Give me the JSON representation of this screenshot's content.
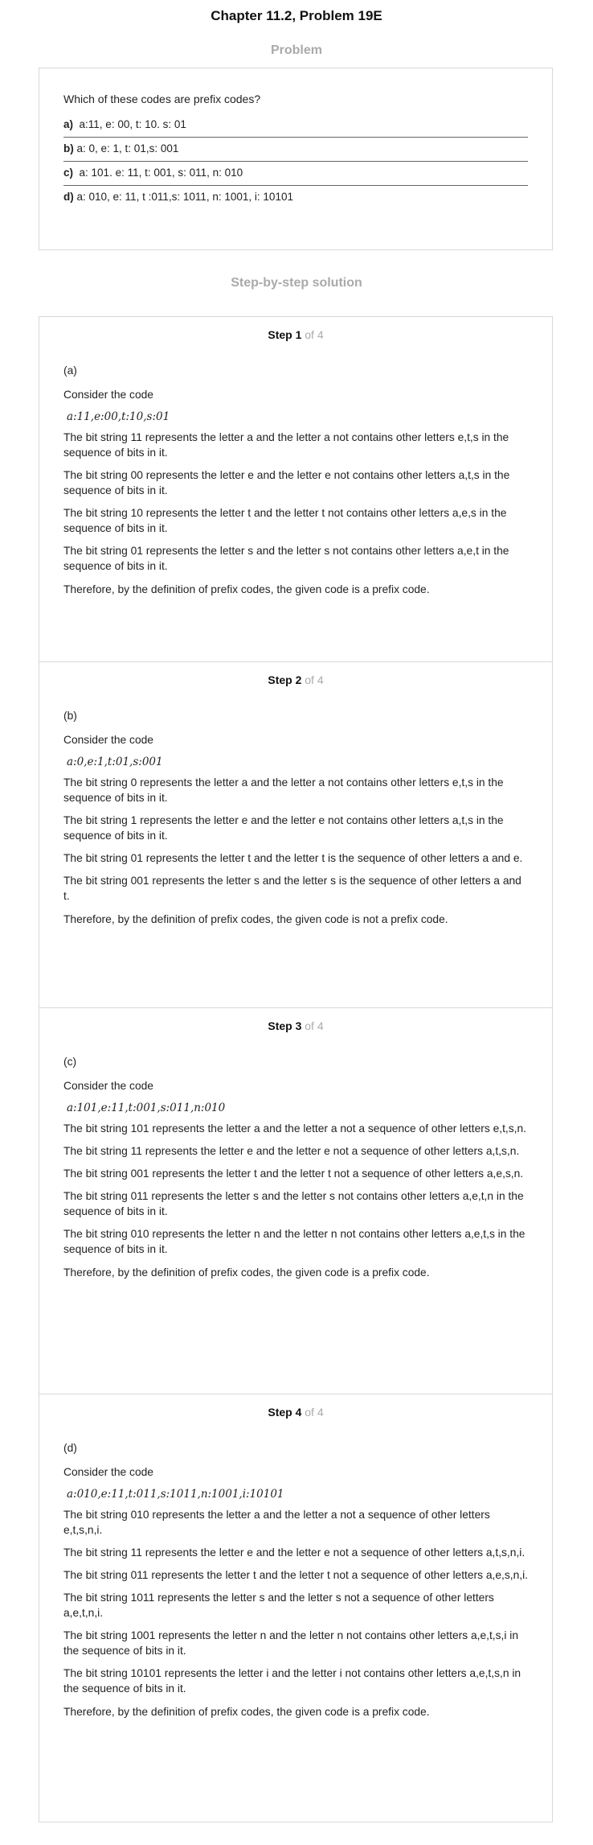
{
  "header": {
    "title": "Chapter 11.2, Problem 19E"
  },
  "problem": {
    "heading": "Problem",
    "question": "Which of these codes are prefix codes?",
    "options": [
      {
        "label": "a)",
        "text": "a:11, e: 00, t: 10. s: 01"
      },
      {
        "label": "b)",
        "text": "a: 0, e: 1, t: 01,s: 001"
      },
      {
        "label": "c)",
        "text": "a: 101. e: 11, t: 001, s: 011, n: 010"
      },
      {
        "label": "d)",
        "text": "a: 010, e: 11, t :011,s: 1011, n: 1001, i: 10101"
      }
    ]
  },
  "solution": {
    "heading": "Step-by-step solution",
    "steps": [
      {
        "num": "Step 1",
        "of": "of 4",
        "part": "(a)",
        "intro": "Consider the code",
        "code": "a:11,e:00,t:10,s:01",
        "lines": [
          "The bit string 11 represents the letter a and the letter a not contains other letters e,t,s in the sequence of bits in it.",
          "The bit string 00 represents the letter e and the letter e not contains other letters a,t,s in the sequence of bits in it.",
          "The bit string 10 represents the letter t and the letter t not contains other letters a,e,s in the sequence of bits in it.",
          "The bit string 01 represents the letter s and the letter s not contains other letters a,e,t in the sequence of bits in it."
        ],
        "conclusion": "Therefore, by the definition of prefix codes, the given code is a prefix code."
      },
      {
        "num": "Step 2",
        "of": "of 4",
        "part": "(b)",
        "intro": "Consider the code",
        "code": "a:0,e:1,t:01,s:001",
        "lines": [
          "The bit string 0 represents the letter a and the letter a not contains other letters e,t,s in the sequence of bits in it.",
          "The bit string 1 represents the letter e and the letter e not contains other letters a,t,s in the sequence of bits in it.",
          "The bit string 01 represents the letter t and the letter t is the sequence of other letters a and e.",
          "The bit string 001 represents the letter s and the letter s is the sequence of other letters a and t."
        ],
        "conclusion": "Therefore, by the definition of prefix codes, the given code is not a prefix code."
      },
      {
        "num": "Step 3",
        "of": "of 4",
        "part": "(c)",
        "intro": "Consider the code",
        "code": "a:101,e:11,t:001,s:011,n:010",
        "lines": [
          "The bit string 101 represents the letter a and the letter a not a sequence of other letters e,t,s,n.",
          "The bit string 11 represents the letter e and the letter e not a sequence of other letters a,t,s,n.",
          "The bit string 001 represents the letter t and the letter t not a sequence of other letters a,e,s,n.",
          "The bit string 011 represents the letter s and the letter s not contains other letters a,e,t,n in the sequence of bits in it.",
          "The bit string 010 represents the letter n and the letter n not contains other letters a,e,t,s in the sequence of bits in it."
        ],
        "conclusion": "Therefore, by the definition of prefix codes, the given code is a prefix code."
      },
      {
        "num": "Step 4",
        "of": "of 4",
        "part": "(d)",
        "intro": "Consider the code",
        "code": "a:010,e:11,t:011,s:1011,n:1001,i:10101",
        "lines": [
          "The bit string 010 represents the letter a and the letter a not a sequence of other letters e,t,s,n,i.",
          "The bit string 11 represents the letter e and the letter e not a sequence of other letters a,t,s,n,i.",
          "The bit string 011 represents the letter t and the letter t not a sequence of other letters a,e,s,n,i.",
          "The bit string 1011 represents the letter s and the letter s not a sequence of other letters a,e,t,n,i.",
          "The bit string 1001 represents the letter n and the letter n not contains other letters a,e,t,s,i in the sequence of bits in it.",
          "The bit string 10101 represents the letter i and the letter i not contains other letters a,e,t,s,n in the sequence of bits in it."
        ],
        "conclusion": "Therefore, by the definition of prefix codes, the given code is a prefix code."
      }
    ]
  }
}
